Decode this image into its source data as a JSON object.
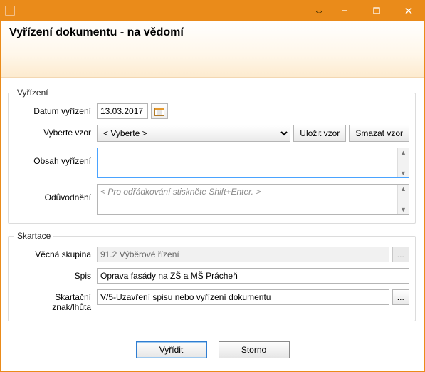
{
  "window": {
    "title": "Vyřízení dokumentu - na vědomí"
  },
  "groups": {
    "vyrizeni": {
      "legend": "Vyřízení",
      "datum_label": "Datum vyřízení",
      "datum_value": "13.03.2017",
      "vzor_label": "Vyberte vzor",
      "vzor_selected": "< Vyberte >",
      "ulozit_vzor": "Uložit vzor",
      "smazat_vzor": "Smazat vzor",
      "obsah_label": "Obsah vyřízení",
      "obsah_value": "",
      "oduvodneni_label": "Odůvodnění",
      "oduvodneni_placeholder": "< Pro odřádkování stiskněte Shift+Enter. >",
      "oduvodneni_value": ""
    },
    "skartace": {
      "legend": "Skartace",
      "vecna_label": "Věcná skupina",
      "vecna_value": "91.2 Výběrové řízení",
      "vecna_dots": "...",
      "spis_label": "Spis",
      "spis_value": "Oprava fasády na ZŠ a MŠ Prácheň",
      "znak_label": "Skartační znak/lhůta",
      "znak_value": "V/5-Uzavření spisu nebo vyřízení dokumentu",
      "znak_dots": "..."
    }
  },
  "footer": {
    "ok": "Vyřídit",
    "cancel": "Storno"
  }
}
